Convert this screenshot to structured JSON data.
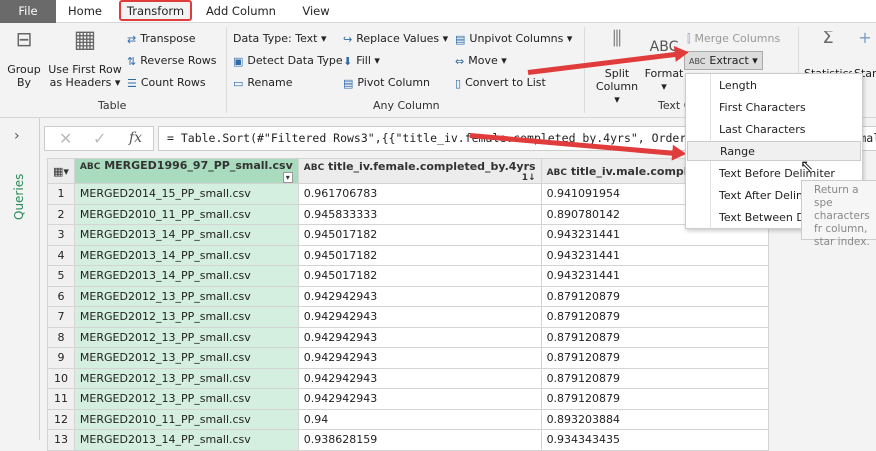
{
  "tabs": [
    "File",
    "Home",
    "Transform",
    "Add Column",
    "View"
  ],
  "ribbon": {
    "table": {
      "group_by": "Group By",
      "use_first_row": "Use First Row as Headers",
      "transpose": "Transpose",
      "reverse_rows": "Reverse Rows",
      "count_rows": "Count Rows",
      "label": "Table"
    },
    "any_column": {
      "data_type": "Data Type: Text",
      "detect": "Detect Data Type",
      "rename": "Rename",
      "replace": "Replace Values",
      "fill": "Fill",
      "pivot": "Pivot Column",
      "unpivot": "Unpivot Columns",
      "move": "Move",
      "convert": "Convert to List",
      "label": "Any Column"
    },
    "text_column": {
      "split": "Split Column",
      "format": "Format",
      "merge": "Merge Columns",
      "extract": "Extract",
      "label": "Text C",
      "statistics": "Statistics",
      "standard": "Stan"
    }
  },
  "queries_label": "Queries",
  "formula": "= Table.Sort(#\"Filtered Rows3\",{{\"title_iv.female.completed_by.4yrs\", Order.Descending}, {\"title_iv.male.comp...",
  "formula_visible_end": "tor",
  "table": {
    "headers": [
      "MERGED1996_97_PP_small.csv",
      "title_iv.female.completed_by.4yrs",
      "title_iv.male.completed_by.4"
    ],
    "rows": [
      [
        "1",
        "MERGED2014_15_PP_small.csv",
        "0.961706783",
        "0.941091954"
      ],
      [
        "2",
        "MERGED2010_11_PP_small.csv",
        "0.945833333",
        "0.890780142"
      ],
      [
        "3",
        "MERGED2013_14_PP_small.csv",
        "0.945017182",
        "0.943231441"
      ],
      [
        "4",
        "MERGED2013_14_PP_small.csv",
        "0.945017182",
        "0.943231441"
      ],
      [
        "5",
        "MERGED2013_14_PP_small.csv",
        "0.945017182",
        "0.943231441"
      ],
      [
        "6",
        "MERGED2012_13_PP_small.csv",
        "0.942942943",
        "0.879120879"
      ],
      [
        "7",
        "MERGED2012_13_PP_small.csv",
        "0.942942943",
        "0.879120879"
      ],
      [
        "8",
        "MERGED2012_13_PP_small.csv",
        "0.942942943",
        "0.879120879"
      ],
      [
        "9",
        "MERGED2012_13_PP_small.csv",
        "0.942942943",
        "0.879120879"
      ],
      [
        "10",
        "MERGED2012_13_PP_small.csv",
        "0.942942943",
        "0.879120879"
      ],
      [
        "11",
        "MERGED2012_13_PP_small.csv",
        "0.942942943",
        "0.879120879"
      ],
      [
        "12",
        "MERGED2010_11_PP_small.csv",
        "0.94",
        "0.893203884"
      ],
      [
        "13",
        "MERGED2013_14_PP_small.csv",
        "0.938628159",
        "0.934343435"
      ]
    ]
  },
  "extract_menu": [
    "Length",
    "First Characters",
    "Last Characters",
    "Range",
    "Text Before Delimiter",
    "Text After Delimiter",
    "Text Between Delimiters"
  ],
  "tooltip": "Return a spe characters fr column, star index.",
  "colors": {
    "highlight": "#e03c3c",
    "key_column": "#d4efdf"
  }
}
